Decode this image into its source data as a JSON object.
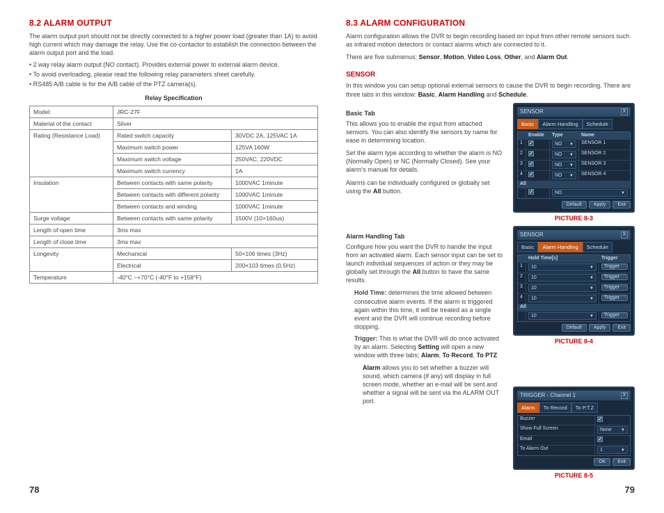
{
  "left": {
    "heading": "8.2 ALARM OUTPUT",
    "intro": "The alarm output port should not be directly connected to a higher power load (greater than 1A) to avoid high current which may damage the relay. Use the co-contactor to establish the connection between the alarm output port and the load.",
    "bullets": [
      "2 way relay alarm output (NO contact). Provides external power to external alarm device.",
      "To avoid overloading, please read the following relay parameters sheet carefully.",
      "RS485 A/B cable is for the A/B cable of the PTZ camera(s)."
    ],
    "tableTitle": "Relay Specification",
    "spec": [
      [
        "Model:",
        "JRC-27F",
        ""
      ],
      [
        "Material of the contact",
        "Silver",
        ""
      ],
      [
        "Rating (Resistance Load)",
        "Rated switch capacity",
        "30VDC 2A, 125VAC 1A"
      ],
      [
        "",
        "Maximum switch power",
        "125VA 160W"
      ],
      [
        "",
        "Maximum switch voltage",
        "250VAC, 220VDC"
      ],
      [
        "",
        "Maximum switch currency",
        "1A"
      ],
      [
        "Insulation",
        "Between contacts with same polarity",
        "1000VAC 1minute"
      ],
      [
        "",
        "Between contacts with different polarity",
        "1000VAC 1minute"
      ],
      [
        "",
        "Between contacts and winding",
        "1000VAC 1minute"
      ],
      [
        "Surge voltage",
        "Between contacts with same polarity",
        "1500V (10×160us)"
      ],
      [
        "Length of open time",
        "3ms max",
        ""
      ],
      [
        "Length of close time",
        "3ms max",
        ""
      ],
      [
        "Longevity",
        "Mechanical",
        "50×106 times (3Hz)"
      ],
      [
        "",
        "Electrical",
        "200×103 times (0.5Hz)"
      ],
      [
        "Temperature",
        "-40°C ~+70°C (-40°F to +158°F)",
        ""
      ]
    ],
    "pageNum": "78"
  },
  "right": {
    "heading": "8.3 ALARM CONFIGURATION",
    "intro1": "Alarm configuration allows the DVR to begin recording based on input from other remote sensors such as infrared motion detectors or contact alarms which are connected to it.",
    "intro2_pre": "There are five submenus; ",
    "submenus": [
      "Sensor",
      "Motion",
      "Video Loss",
      "Other",
      "Alarm Out"
    ],
    "sensor": {
      "title": "SENSOR",
      "intro_a": "In this window you can setup optional external sensors to cause the DVR to begin recording. There are three tabs in this window: ",
      "tabs": [
        "Basic",
        "Alarm Handling",
        "Schedule"
      ],
      "basic": {
        "title": "Basic Tab",
        "p1": "This allows you to enable the input from attached sensors. You can also identify the sensors by name for ease in determining location.",
        "p2_a": "Set the alarm type according to whether the alarm is NO (Normally Open) or NC (Normally Closed). See your alarm's manual for details.",
        "p3_a": "Alarms can be individually configured or globally set using the ",
        "p3_b": "All",
        "p3_c": " button."
      },
      "alarmHandling": {
        "title": "Alarm Handling Tab",
        "p1_a": "Configure how you want the DVR to handle the input from an activated alarm. Each sensor input can be set to launch individual sequences of action or they may be globally set through the ",
        "p1_b": "All",
        "p1_c": " button to have the same results.",
        "hold_term": "Hold Time:",
        "hold_body": " determines the time allowed between consecutive alarm events. If the alarm is triggered again within this time, it will be treated as a single event and the DVR will continue recording before stopping.",
        "trig_term": "Trigger:",
        "trig_body_a": " This is what the DVR will do once activated by an alarm. Selecting ",
        "trig_body_b": "Setting",
        "trig_body_c": " will open a new window with three tabs; ",
        "trig_tabs": [
          "Alarm",
          "To Record",
          "To PTZ"
        ],
        "alarm_body_a": "Alarm",
        "alarm_body_b": " allows you to set whether a buzzer will sound, which camera (if any) will display in full screen mode, whether an e-mail will be sent and whether a signal will be sent via the ALARM OUT port."
      }
    },
    "fig1": {
      "caption": "PICTURE 8-3",
      "winTitle": "SENSOR",
      "tabs": [
        "Basic",
        "Alarm Handling",
        "Schedule"
      ],
      "headers": [
        "",
        "Enable",
        "Type",
        "Name"
      ],
      "rows": [
        [
          "1",
          "on",
          "NO",
          "SENSOR 1"
        ],
        [
          "2",
          "on",
          "NO",
          "SENSOR 2"
        ],
        [
          "3",
          "on",
          "NO",
          "SENSOR 3"
        ],
        [
          "4",
          "on",
          "NO",
          "SENSOR 4"
        ]
      ],
      "allLabel": "All",
      "allType": "NO",
      "buttons": [
        "Default",
        "Apply",
        "Exit"
      ]
    },
    "fig2": {
      "caption": "PICTURE 8-4",
      "winTitle": "SENSOR",
      "tabs": [
        "Basic",
        "Alarm Handling",
        "Schedule"
      ],
      "headers": [
        "",
        "Hold Time[s]",
        "Trigger"
      ],
      "rows": [
        [
          "1",
          "10",
          "Trigger"
        ],
        [
          "2",
          "10",
          "Trigger"
        ],
        [
          "3",
          "10",
          "Trigger"
        ],
        [
          "4",
          "10",
          "Trigger"
        ]
      ],
      "allLabel": "All",
      "allHold": "10",
      "allTrig": "Trigger",
      "buttons": [
        "Default",
        "Apply",
        "Exit"
      ]
    },
    "fig3": {
      "caption": "PICTURE 8-5",
      "winTitle": "TRIGGER - Channel 1",
      "tabs": [
        "Alarm",
        "To Record",
        "To P.T.Z"
      ],
      "rows": [
        [
          "Buzzer",
          "check"
        ],
        [
          "Show Full Screen",
          "None"
        ],
        [
          "Email",
          "check"
        ],
        [
          "To Alarm Out",
          "1"
        ]
      ],
      "buttons": [
        "OK",
        "Exit"
      ]
    },
    "pageNum": "79"
  }
}
